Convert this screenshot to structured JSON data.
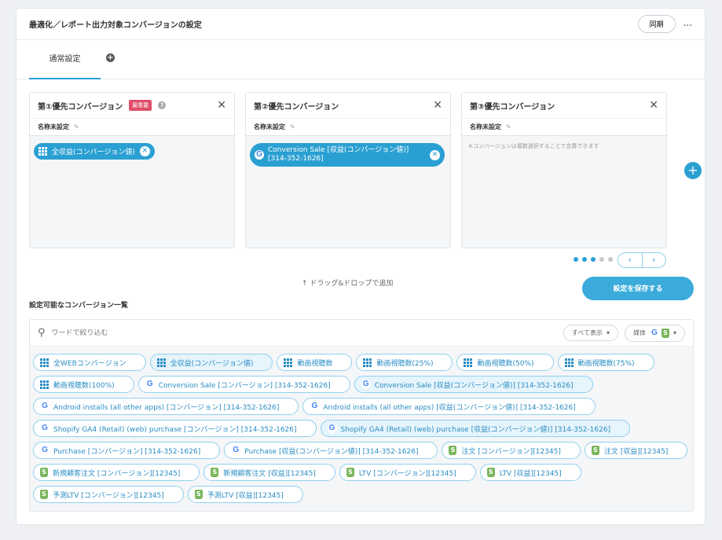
{
  "header": {
    "title": "最適化／レポート出力対象コンバージョンの設定",
    "sync_label": "同期",
    "more_label": "..."
  },
  "tabs": {
    "active": "通常設定",
    "add": "+"
  },
  "columns": [
    {
      "title": "第①優先コンバージョン",
      "badge": "最重要",
      "help": "?",
      "name": "名称未設定",
      "chip": {
        "icon": "grid",
        "label": "全収益(コンバージョン値)"
      }
    },
    {
      "title": "第②優先コンバージョン",
      "name": "名称未設定",
      "chip": {
        "icon": "google",
        "label": "Conversion Sale [収益(コンバージョン値)] [314-352-1626]"
      }
    },
    {
      "title": "第③優先コンバージョン",
      "name": "名称未設定",
      "hint": "※コンバージョンは複数選択することで合算できます"
    }
  ],
  "pager": {
    "pages": 5,
    "current": 3
  },
  "drag_hint": "↑ ドラッグ&ドロップで追加",
  "save_label": "設定を保存する",
  "list": {
    "title": "設定可能なコンバージョン一覧",
    "search_placeholder": "ワードで絞り込む",
    "filter_label": "すべて表示",
    "media_label": "媒体",
    "chips": [
      {
        "icon": "grid",
        "label": "全WEBコンバージョン",
        "selected": false
      },
      {
        "icon": "grid",
        "label": "全収益(コンバージョン値)",
        "selected": true
      },
      {
        "icon": "grid",
        "label": "動画視聴数",
        "selected": false
      },
      {
        "icon": "grid",
        "label": "動画視聴数(25%)",
        "selected": false
      },
      {
        "icon": "grid",
        "label": "動画視聴数(50%)",
        "selected": false
      },
      {
        "icon": "grid",
        "label": "動画視聴数(75%)",
        "selected": false
      },
      {
        "icon": "grid",
        "label": "動画視聴数(100%)",
        "selected": false
      },
      {
        "icon": "google",
        "label": "Conversion Sale [コンバージョン] [314-352-1626]",
        "selected": false
      },
      {
        "icon": "google",
        "label": "Conversion Sale [収益(コンバージョン値)] [314-352-1626]",
        "selected": true
      },
      {
        "icon": "google",
        "label": "Android installs (all other apps) [コンバージョン] [314-352-1626]",
        "selected": false
      },
      {
        "icon": "google",
        "label": "Android installs (all other apps) [収益(コンバージョン値)] [314-352-1626]",
        "selected": false
      },
      {
        "icon": "google",
        "label": "Shopify GA4 (Retail) (web) purchase [コンバージョン] [314-352-1626]",
        "selected": false
      },
      {
        "icon": "google",
        "label": "Shopify GA4 (Retail) (web) purchase [収益(コンバージョン値)] [314-352-1626]",
        "selected": true
      },
      {
        "icon": "google",
        "label": "Purchase [コンバージョン] [314-352-1626]",
        "selected": false
      },
      {
        "icon": "google",
        "label": "Purchase [収益(コンバージョン値)] [314-352-1626]",
        "selected": false
      },
      {
        "icon": "shopify",
        "label": "注文 [コンバージョン][12345]",
        "selected": false
      },
      {
        "icon": "shopify",
        "label": "注文 [収益][12345]",
        "selected": false
      },
      {
        "icon": "shopify",
        "label": "新規顧客注文 [コンバージョン][12345]",
        "selected": false
      },
      {
        "icon": "shopify",
        "label": "新規顧客注文 [収益][12345]",
        "selected": false
      },
      {
        "icon": "shopify",
        "label": "LTV [コンバージョン][12345]",
        "selected": false
      },
      {
        "icon": "shopify",
        "label": "LTV [収益][12345]",
        "selected": false
      },
      {
        "icon": "shopify",
        "label": "予測LTV [コンバージョン][12345]",
        "selected": false
      },
      {
        "icon": "shopify",
        "label": "予測LTV [収益][12345]",
        "selected": false
      }
    ]
  }
}
